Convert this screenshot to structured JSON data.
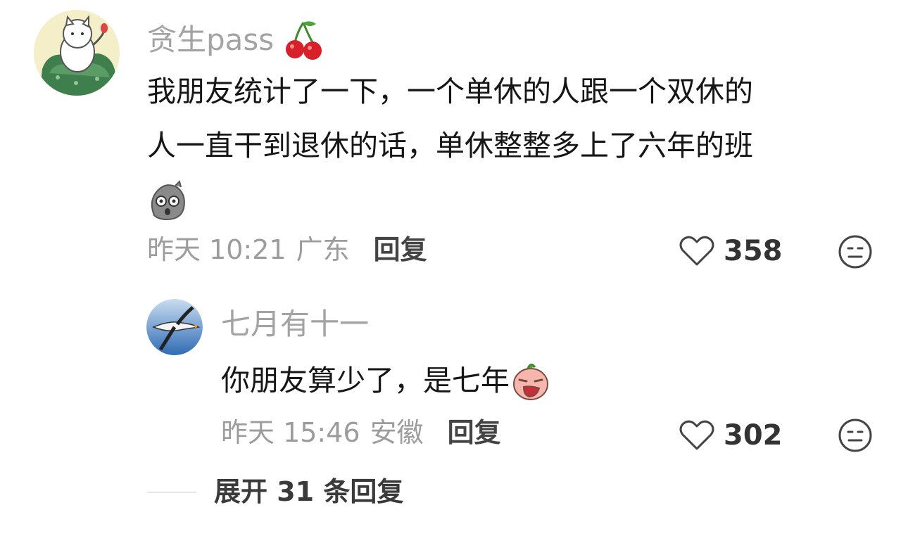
{
  "comment": {
    "username": "贪生pass",
    "username_emoji": "cherry-icon",
    "text_line1": "我朋友统计了一下，一个单休的人跟一个双休的",
    "text_line2": "人一直干到退休的话，单休整整多上了六年的班",
    "inline_emoji": "shocked-stone-emoji",
    "time": "昨天 10:21",
    "location": "广东",
    "reply_label": "回复",
    "likes": "358",
    "dislike_icon": "meh-face-icon"
  },
  "reply": {
    "username": "七月有十一",
    "text": "你朋友算少了，是七年",
    "inline_emoji": "crying-face-emoji",
    "time": "昨天 15:46",
    "location": "安徽",
    "reply_label": "回复",
    "likes": "302",
    "dislike_icon": "meh-face-icon"
  },
  "expand": {
    "label": "展开 31 条回复"
  },
  "colors": {
    "muted": "#9c9c9c",
    "text": "#161616",
    "icon": "#444444"
  }
}
